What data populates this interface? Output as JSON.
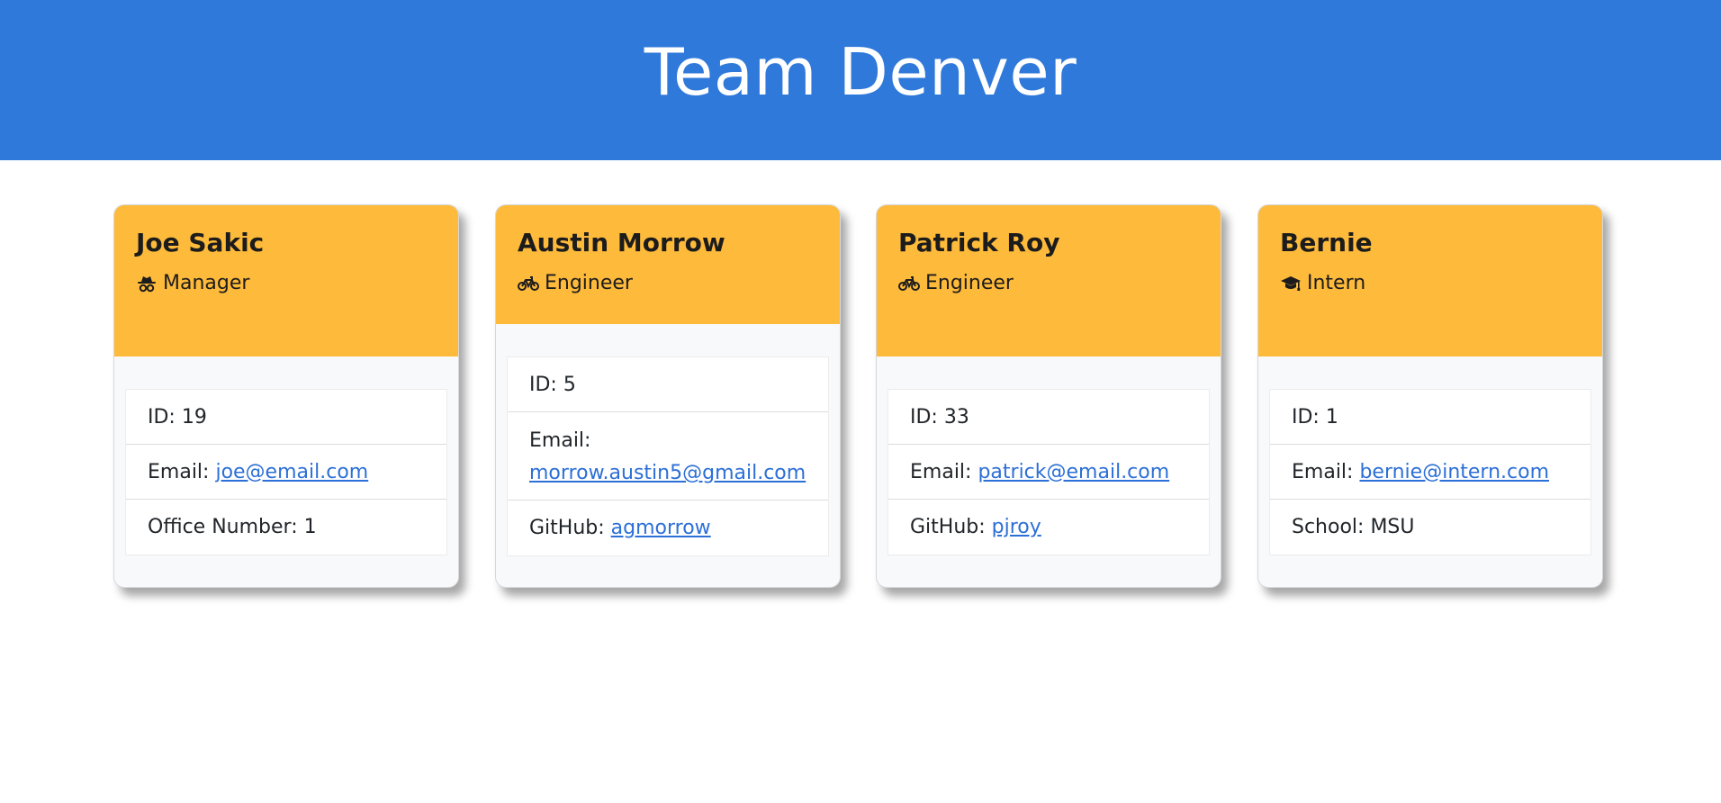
{
  "page": {
    "title": "Team Denver"
  },
  "colors": {
    "header": "#2f79da",
    "card_head": "#feba3a",
    "link": "#2c6fd6"
  },
  "members": [
    {
      "name": "Joe Sakic",
      "role": "Manager",
      "role_icon": "user-secret-icon",
      "id": "ID: 19",
      "email_label": "Email:",
      "email": "joe@email.com",
      "extra_text": "Office Number: 1"
    },
    {
      "name": "Austin Morrow",
      "role": "Engineer",
      "role_icon": "bicycle-icon",
      "id": "ID: 5",
      "email_label": "Email:",
      "email": "morrow.austin5@gmail.com",
      "extra_label": "GitHub:",
      "extra_link": "agmorrow"
    },
    {
      "name": "Patrick Roy",
      "role": "Engineer",
      "role_icon": "bicycle-icon",
      "id": "ID: 33",
      "email_label": "Email:",
      "email": "patrick@email.com",
      "extra_label": "GitHub:",
      "extra_link": "pjroy"
    },
    {
      "name": "Bernie",
      "role": "Intern",
      "role_icon": "graduation-cap-icon",
      "id": "ID: 1",
      "email_label": "Email:",
      "email": "bernie@intern.com",
      "extra_text": "School: MSU"
    }
  ]
}
